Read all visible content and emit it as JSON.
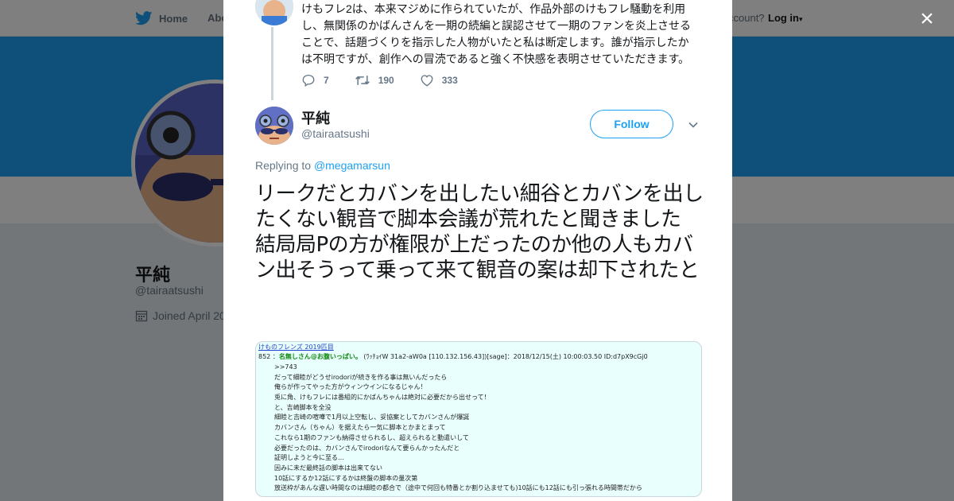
{
  "nav": {
    "home": "Home",
    "about": "Abo",
    "account_prompt": "ccount?",
    "login": "Log in"
  },
  "profile_bg": {
    "name": "平純",
    "handle": "@tairaatsushi",
    "joined": "Joined April 20"
  },
  "modal": {
    "close_label": "×",
    "prev_tweet": {
      "text": "けもフレ2は、本来マジめに作られていたが、作品外部のけもフレ騒動を利用し、無関係のかばんさんを一期の続編と誤認させて一期のファンを炎上させることで、話題づくりを指示した人物がいたと私は断定します。誰が指示したかは不明ですが、創作への冒涜であると強く不快感を表明させていただきます。",
      "replies": "7",
      "retweets": "190",
      "likes": "333"
    },
    "tweet": {
      "name": "平純",
      "handle": "@tairaatsushi",
      "follow_label": "Follow",
      "replying_prefix": "Replying to ",
      "replying_to": "@megamarsun",
      "text": "リークだとカバンを出したい細谷とカバンを出したくない観音で脚本会議が荒れたと聞きました\n結局局Pの方が権限が上だったのか他の人もカバン出そうって乗って来て観音の案は却下されたと"
    },
    "media": {
      "header": "けものフレンズ 2019匹目",
      "post_number": "852",
      "post_name": "名無しさん@お腹いっぱい。",
      "post_meta": "(ﾜｯﾁｮｲW 31a2-aW0a [110.132.156.43])[sage]：2018/12/15(土) 10:00:03.50 ID:d7pX9cGj0",
      "lines": [
        ">>743",
        "だって細睦がどうせirodoriが続きを作る事は無いんだったら",
        "俺らが作ってやった方がウィンウインになるじゃん！",
        "兎に角、けもフレには番組的にかばんちゃんは絶対に必要だから出せって！",
        "と、吉崎脚本を全没",
        "細睦と吉崎の喧嘩で1月以上空転し、妥協案としてカバンさんが爆誕",
        "カバンさん（ちゃん）を据えたら一気に脚本とかまとまって",
        "これなら1期のファンも納得させられるし、超えられると動遣いして",
        "必要だったのは、カバンさんでirodoriなんて要らんかったんだと",
        "証明しようと今に至る…",
        "因みに未だ最終話の脚本は出来てない",
        "10話にするか12話にするかは終盤の脚本の量次第",
        "放送枠があんな遅い時間なのは細睦の都合で（途中で何回も特番とか割り込ませても)10話にも12話にも引っ張れる時間帯だから"
      ]
    }
  }
}
